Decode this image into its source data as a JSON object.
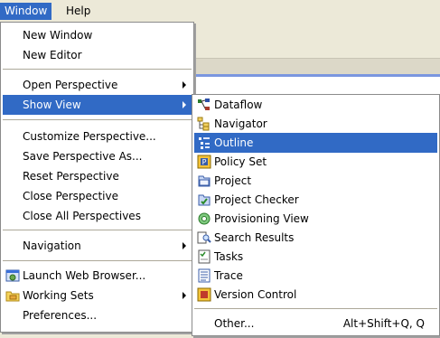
{
  "menubar": {
    "items": [
      {
        "label": "Window"
      },
      {
        "label": "Help"
      }
    ]
  },
  "window_menu": {
    "items": [
      {
        "label": "New Window"
      },
      {
        "label": "New Editor"
      },
      {
        "label": "Open Perspective"
      },
      {
        "label": "Show View"
      },
      {
        "label": "Customize Perspective..."
      },
      {
        "label": "Save Perspective As..."
      },
      {
        "label": "Reset Perspective"
      },
      {
        "label": "Close Perspective"
      },
      {
        "label": "Close All Perspectives"
      },
      {
        "label": "Navigation"
      },
      {
        "label": "Launch Web Browser..."
      },
      {
        "label": "Working Sets"
      },
      {
        "label": "Preferences..."
      }
    ]
  },
  "show_view_menu": {
    "items": [
      {
        "label": "Dataflow",
        "icon": "dataflow-icon"
      },
      {
        "label": "Navigator",
        "icon": "navigator-icon"
      },
      {
        "label": "Outline",
        "icon": "outline-icon"
      },
      {
        "label": "Policy Set",
        "icon": "policy-set-icon"
      },
      {
        "label": "Project",
        "icon": "project-icon"
      },
      {
        "label": "Project Checker",
        "icon": "project-checker-icon"
      },
      {
        "label": "Provisioning View",
        "icon": "provisioning-view-icon"
      },
      {
        "label": "Search Results",
        "icon": "search-results-icon"
      },
      {
        "label": "Tasks",
        "icon": "tasks-icon"
      },
      {
        "label": "Trace",
        "icon": "trace-icon"
      },
      {
        "label": "Version Control",
        "icon": "version-control-icon"
      },
      {
        "label": "Other...",
        "accelerator": "Alt+Shift+Q, Q"
      }
    ]
  },
  "colors": {
    "highlight": "#316ac5",
    "menu_bg": "#ffffff",
    "chrome_bg": "#ece9d8"
  }
}
